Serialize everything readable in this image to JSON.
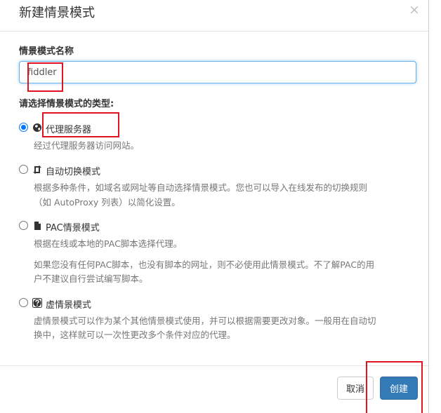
{
  "dialog": {
    "title": "新建情景模式",
    "close_glyph": "×"
  },
  "form": {
    "name_label": "情景模式名称",
    "name_value": "fiddler",
    "type_label": "请选择情景模式的类型:"
  },
  "options": [
    {
      "label": "代理服务器",
      "icon": "globe-icon",
      "selected": true,
      "desc": [
        "经过代理服务器访问网站。"
      ]
    },
    {
      "label": "自动切换模式",
      "icon": "retweet-icon",
      "selected": false,
      "desc": [
        "根据多种条件，如域名或网址等自动选择情景模式。您也可以导入在线发布的切换规则",
        "（如 AutoProxy 列表）以简化设置。"
      ]
    },
    {
      "label": "PAC情景模式",
      "icon": "file-icon",
      "selected": false,
      "desc": [
        "根据在线或本地的PAC脚本选择代理。",
        "如果您没有任何PAC脚本，也没有脚本的网址，则不必使用此情景模式。不了解PAC的用",
        "户不建议自行尝试编写脚本。"
      ]
    },
    {
      "label": "虚情景模式",
      "icon": "question-circle-icon",
      "selected": false,
      "desc": [
        "虚情景模式可以作为某个其他情景模式使用，并可以根据需要更改对象。一般用在自动切",
        "换中，这样就可以一次性更改多个条件对应的代理。"
      ]
    }
  ],
  "footer": {
    "cancel_label": "取消",
    "create_label": "创建"
  },
  "colors": {
    "primary": "#337ab7",
    "annotation_red": "#e0141e",
    "radio_checked": "#0075ff"
  }
}
